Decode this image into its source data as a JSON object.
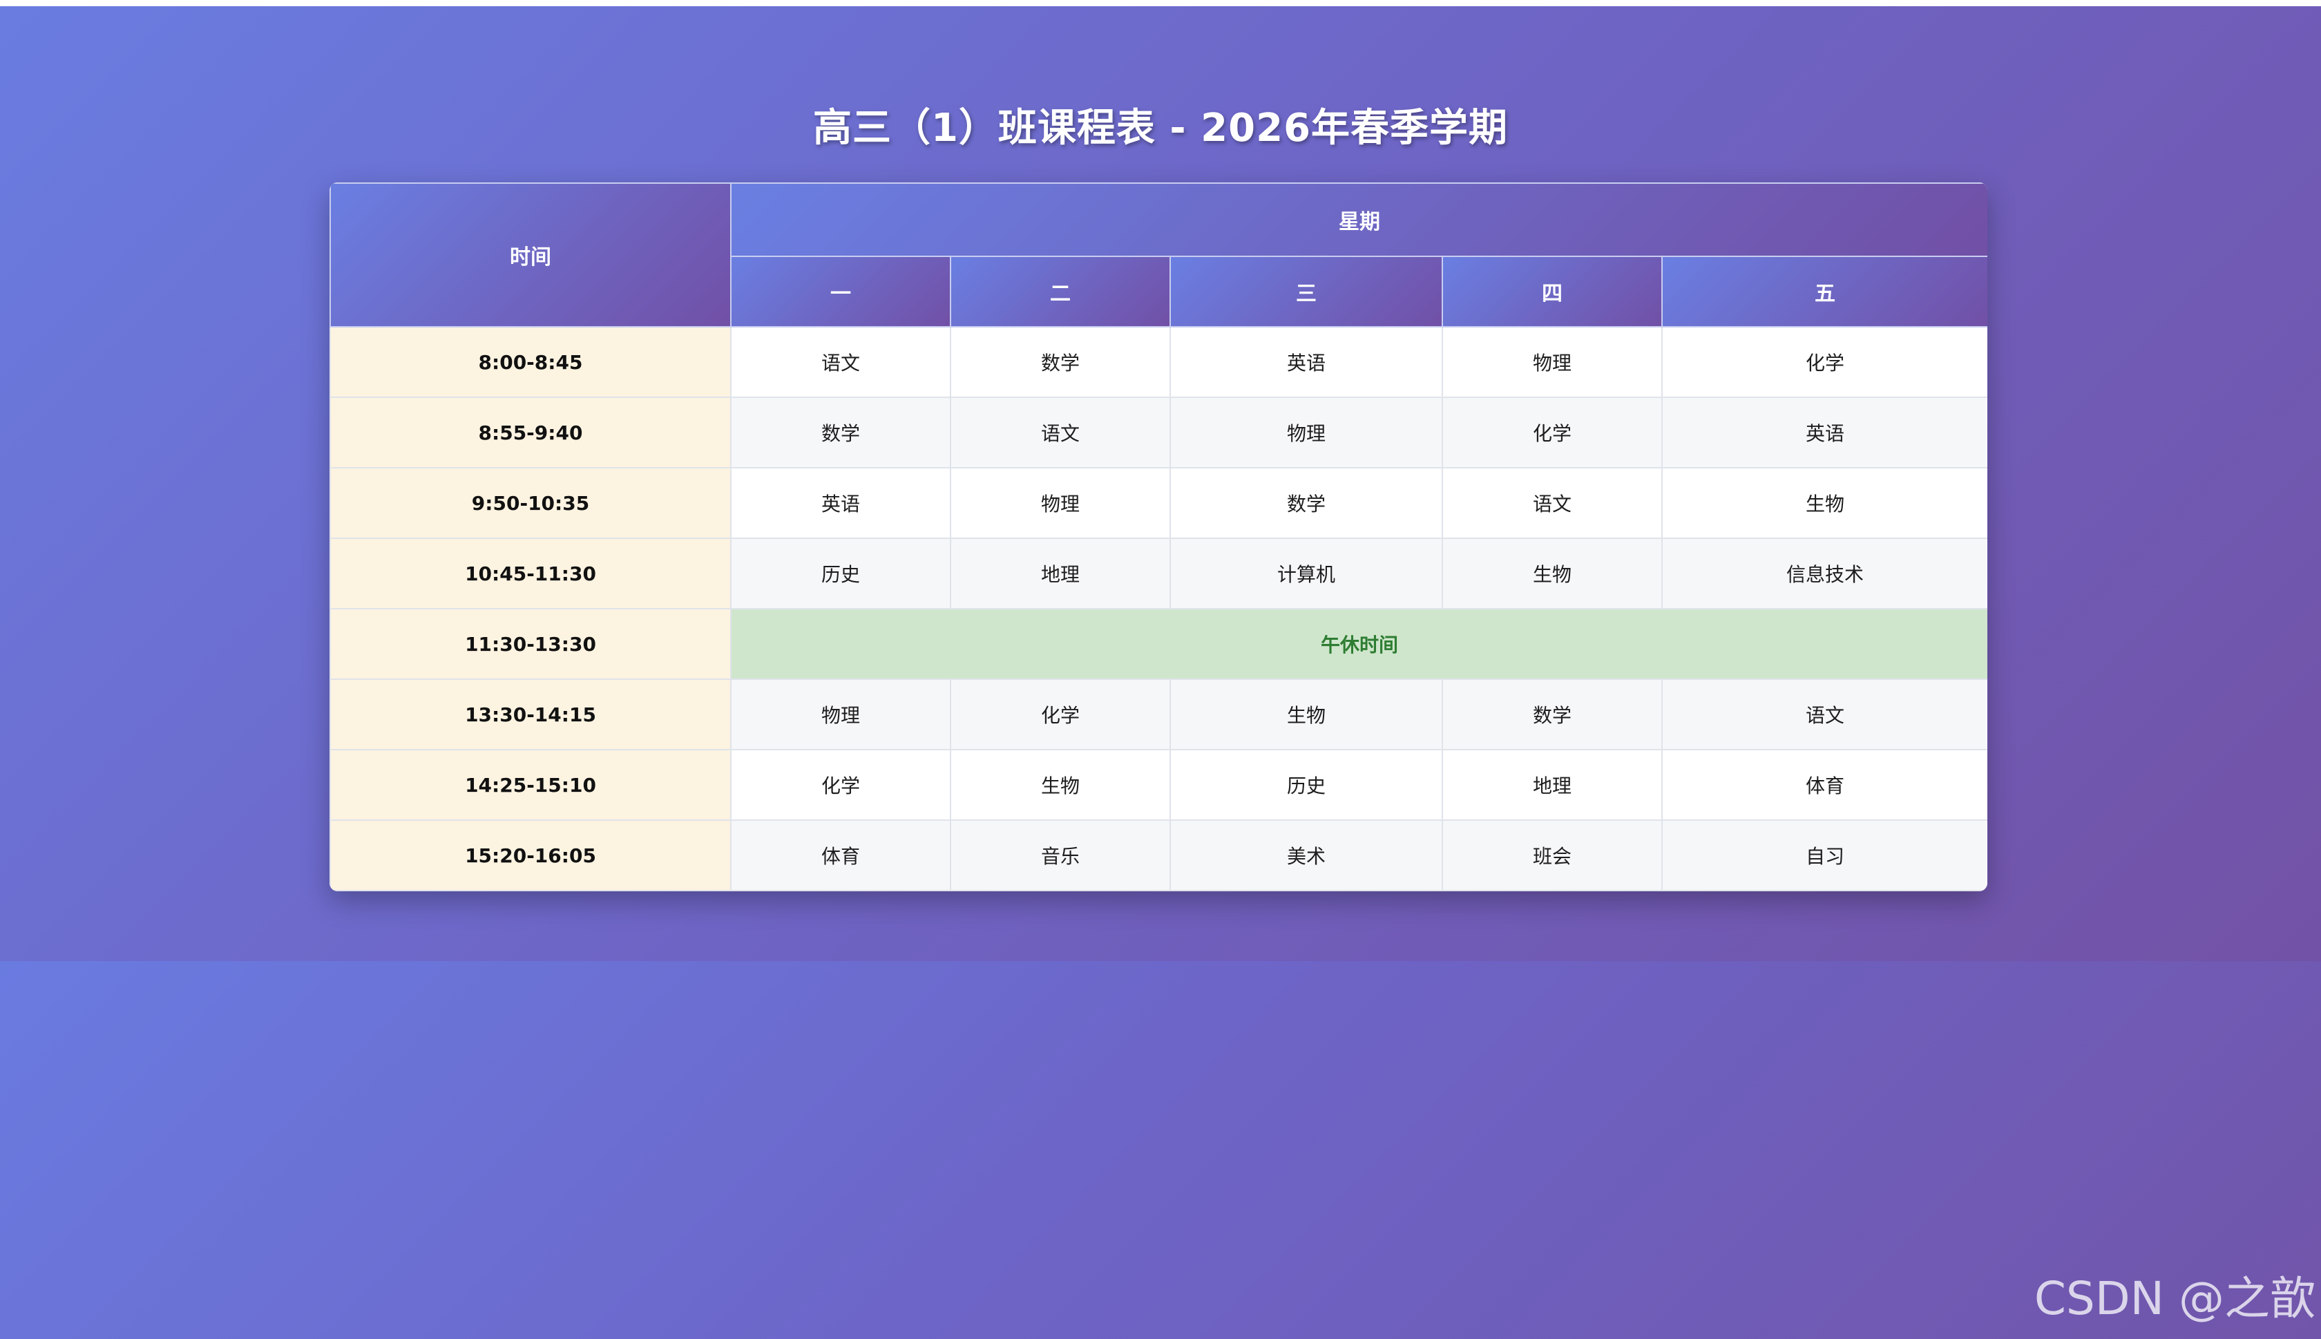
{
  "title": "高三（1）班课程表 - 2026年春季学期",
  "header": {
    "time_label": "时间",
    "week_label": "星期",
    "days": [
      "一",
      "二",
      "三",
      "四",
      "五"
    ]
  },
  "rows": [
    {
      "time": "8:00-8:45",
      "courses": [
        "语文",
        "数学",
        "英语",
        "物理",
        "化学"
      ]
    },
    {
      "time": "8:55-9:40",
      "courses": [
        "数学",
        "语文",
        "物理",
        "化学",
        "英语"
      ]
    },
    {
      "time": "9:50-10:35",
      "courses": [
        "英语",
        "物理",
        "数学",
        "语文",
        "生物"
      ]
    },
    {
      "time": "10:45-11:30",
      "courses": [
        "历史",
        "地理",
        "计算机",
        "生物",
        "信息技术"
      ]
    },
    {
      "time": "11:30-13:30",
      "lunch": "午休时间"
    },
    {
      "time": "13:30-14:15",
      "courses": [
        "物理",
        "化学",
        "生物",
        "数学",
        "语文"
      ]
    },
    {
      "time": "14:25-15:10",
      "courses": [
        "化学",
        "生物",
        "历史",
        "地理",
        "体育"
      ]
    },
    {
      "time": "15:20-16:05",
      "courses": [
        "体育",
        "音乐",
        "美术",
        "班会",
        "自习"
      ]
    }
  ],
  "watermark": "CSDN @之歆",
  "colors": {
    "header_gradient_start": "#6a7fe2",
    "header_gradient_end": "#7150a6",
    "time_column": "#fdf3e1",
    "lunch_bg": "#cfe6cc",
    "lunch_text": "#2e7d32",
    "background_start": "#6b7be0",
    "background_end": "#7052a8"
  }
}
